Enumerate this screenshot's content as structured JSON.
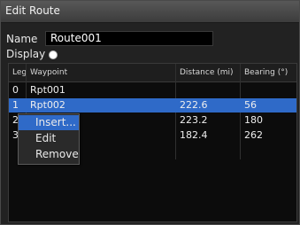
{
  "window": {
    "title": "Edit Route"
  },
  "form": {
    "name_label": "Name",
    "name_value": "Route001",
    "display_label": "Display"
  },
  "table": {
    "headers": {
      "leg": "Leg",
      "waypoint": "Waypoint",
      "distance": "Distance (mi)",
      "bearing": "Bearing (°)"
    },
    "rows": [
      {
        "leg": "0",
        "waypoint": "Rpt001",
        "distance": "",
        "bearing": ""
      },
      {
        "leg": "1",
        "waypoint": "Rpt002",
        "distance": "222.6",
        "bearing": "56",
        "selected": true
      },
      {
        "leg": "2",
        "waypoint": "",
        "distance": "223.2",
        "bearing": "180"
      },
      {
        "leg": "3",
        "waypoint": "",
        "distance": "182.4",
        "bearing": "262"
      }
    ]
  },
  "context_menu": {
    "items": [
      {
        "label": "Insert...",
        "active": true
      },
      {
        "label": "Edit"
      },
      {
        "label": "Remove"
      }
    ]
  },
  "colors": {
    "selection": "#2f6ac8",
    "background": "#0c0c0c"
  }
}
